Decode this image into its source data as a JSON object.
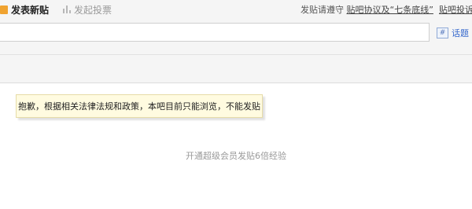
{
  "tabs": {
    "post_label": "发表新贴",
    "vote_label": "发起投票"
  },
  "rules": {
    "prefix": "发贴请遵守 ",
    "agreement_link": "贴吧协议及“七条底线”",
    "complaint_link": "贴吧投诉"
  },
  "title_field": {
    "value": "",
    "placeholder": ""
  },
  "topic": {
    "icon_glyph": "#",
    "label": "话题"
  },
  "editor": {
    "notice": "抱歉，根据相关法律法规和政策，本吧目前只能浏览，不能发贴",
    "vip_hint": "开通超级会员发贴6倍经验"
  },
  "colors": {
    "accent_orange": "#f0a330",
    "link_blue": "#3366cc",
    "notice_bg": "#fffbe0"
  }
}
